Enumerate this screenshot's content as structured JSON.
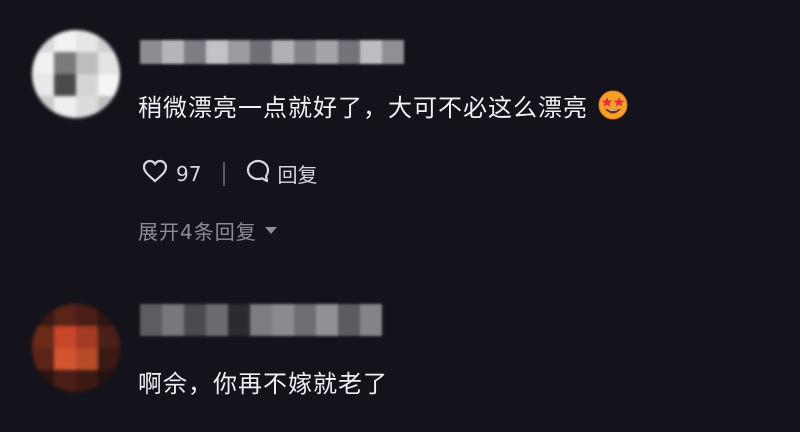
{
  "comments": [
    {
      "text": "稍微漂亮一点就好了，大可不必这么漂亮",
      "emoji": "star-struck-emoji",
      "likes": "97",
      "reply_label": "回复",
      "expand_label": "展开4条回复"
    },
    {
      "text": "啊佘，你再不嫁就老了"
    }
  ],
  "colors": {
    "background": "#14131b",
    "text": "#f1f0f4",
    "secondary": "#8d8c94"
  },
  "icons": [
    "heart-icon",
    "comment-bubble-icon",
    "caret-down-icon",
    "star-struck-emoji"
  ]
}
